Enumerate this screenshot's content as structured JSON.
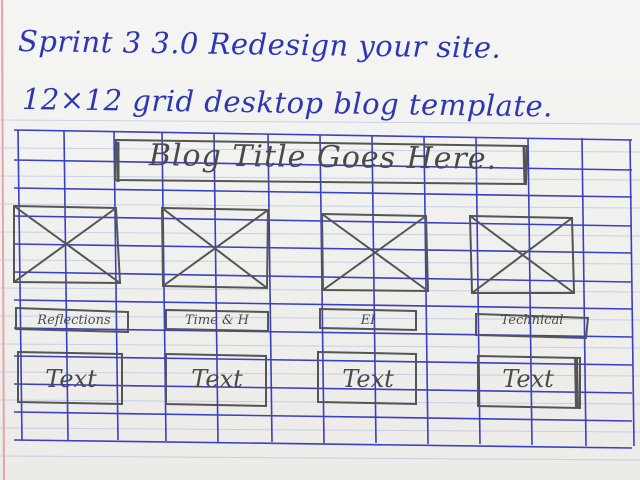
{
  "notes": {
    "line1": "Sprint 3  3.0 Redesign your site.",
    "line2": "12×12 grid desktop blog template."
  },
  "wireframe": {
    "title": "Blog Title Goes Here.",
    "columns": [
      {
        "category": "Reflections",
        "text": "Text"
      },
      {
        "category": "Time & H",
        "text": "Text"
      },
      {
        "category": "EI",
        "text": "Text"
      },
      {
        "category": "Technical",
        "text": "Text"
      }
    ]
  },
  "colors": {
    "ink_blue": "#2c37b4",
    "grid_blue": "#3a3fc4",
    "rule_blue": "#b8c2e6",
    "margin_red": "#e7a3ad",
    "pencil": "#4a4a4a"
  }
}
